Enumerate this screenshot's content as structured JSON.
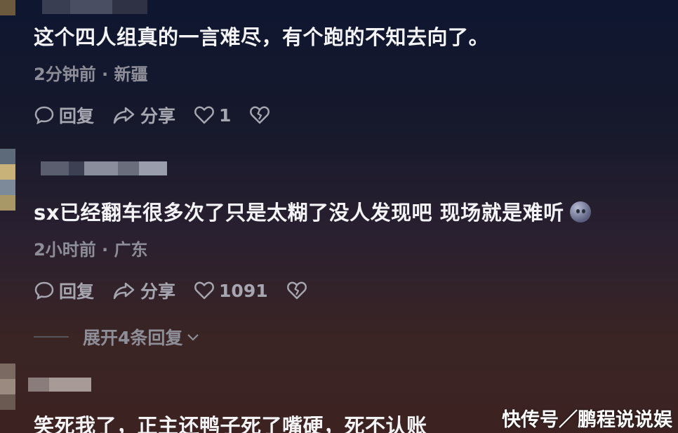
{
  "comments": [
    {
      "text": "这个四人组真的一言难尽，有个跑的不知去向了。",
      "meta": "2分钟前 · 新疆",
      "reply_label": "回复",
      "share_label": "分享",
      "like_count": "1"
    },
    {
      "text": "sx已经翻车很多次了只是太糊了没人发现吧 现场就是难听",
      "meta": "2小时前 · 广东",
      "reply_label": "回复",
      "share_label": "分享",
      "like_count": "1091",
      "expand_replies": "展开4条回复"
    },
    {
      "text": "笑死我了，正主还鸭子死了嘴硬，死不认账"
    }
  ],
  "watermark": "快传号／鹏程说说娱",
  "icons": [
    "reply-icon",
    "share-icon",
    "heart-icon",
    "broken-heart-icon",
    "chevron-down-icon"
  ]
}
